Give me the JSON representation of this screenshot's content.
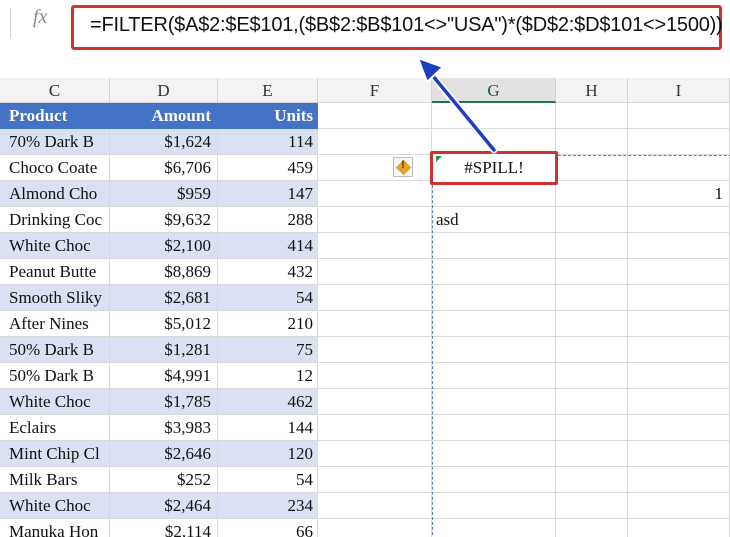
{
  "formula_bar": {
    "fx_label": "fx",
    "formula": "=FILTER($A$2:$E$101,($B$2:$B$101<>\"USA\")*($D$2:$D$101<>1500))"
  },
  "columns": [
    "C",
    "D",
    "E",
    "F",
    "G",
    "H",
    "I"
  ],
  "selected_column": "G",
  "table": {
    "headers": {
      "product": "Product",
      "amount": "Amount",
      "units": "Units"
    },
    "rows": [
      {
        "product": "70% Dark B",
        "amount": "$1,624",
        "units": "114"
      },
      {
        "product": "Choco Coate",
        "amount": "$6,706",
        "units": "459"
      },
      {
        "product": "Almond Cho",
        "amount": "$959",
        "units": "147"
      },
      {
        "product": "Drinking Coc",
        "amount": "$9,632",
        "units": "288"
      },
      {
        "product": "White Choc",
        "amount": "$2,100",
        "units": "414"
      },
      {
        "product": "Peanut Butte",
        "amount": "$8,869",
        "units": "432"
      },
      {
        "product": "Smooth Sliky",
        "amount": "$2,681",
        "units": "54"
      },
      {
        "product": "After Nines",
        "amount": "$5,012",
        "units": "210"
      },
      {
        "product": "50% Dark B",
        "amount": "$1,281",
        "units": "75"
      },
      {
        "product": "50% Dark B",
        "amount": "$4,991",
        "units": "12"
      },
      {
        "product": "White Choc",
        "amount": "$1,785",
        "units": "462"
      },
      {
        "product": "Eclairs",
        "amount": "$3,983",
        "units": "144"
      },
      {
        "product": "Mint Chip Cl",
        "amount": "$2,646",
        "units": "120"
      },
      {
        "product": "Milk Bars",
        "amount": "$252",
        "units": "54"
      },
      {
        "product": "White Choc",
        "amount": "$2,464",
        "units": "234"
      },
      {
        "product": "Manuka Hon",
        "amount": "$2,114",
        "units": "66"
      }
    ]
  },
  "spill_cell": {
    "text": "#SPILL!"
  },
  "i_value": "1",
  "g_text": "asd",
  "colors": {
    "header_blue": "#4472c4",
    "band_blue": "#d9e1f2",
    "highlight_red": "#d0332f",
    "arrow_blue": "#1d3fbf"
  }
}
